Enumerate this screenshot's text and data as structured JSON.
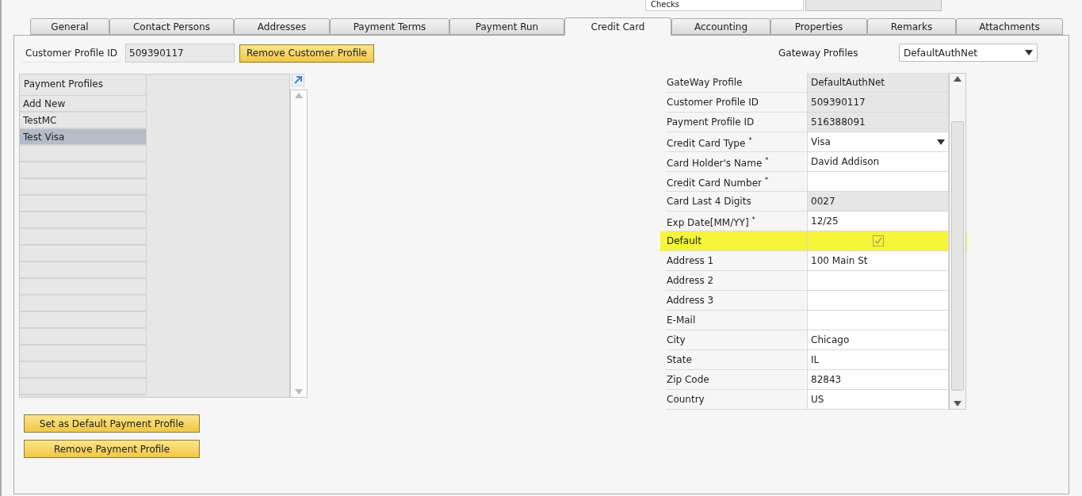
{
  "top_strip": {
    "label": "Checks"
  },
  "tabs": [
    {
      "label": "General",
      "selected": false
    },
    {
      "label": "Contact Persons",
      "selected": false
    },
    {
      "label": "Addresses",
      "selected": false
    },
    {
      "label": "Payment Terms",
      "selected": false
    },
    {
      "label": "Payment Run",
      "selected": false
    },
    {
      "label": "Credit Card",
      "selected": true
    },
    {
      "label": "Accounting",
      "selected": false
    },
    {
      "label": "Properties",
      "selected": false
    },
    {
      "label": "Remarks",
      "selected": false
    },
    {
      "label": "Attachments",
      "selected": false
    }
  ],
  "customer_profile": {
    "label": "Customer Profile ID",
    "value": "509390117",
    "button": "Remove Customer Profile"
  },
  "gateway_profiles": {
    "label": "Gateway Profiles",
    "value": "DefaultAuthNet"
  },
  "payment_profiles": {
    "header": "Payment Profiles",
    "rows": [
      {
        "name": "Add New",
        "selected": false
      },
      {
        "name": "TestMC",
        "selected": false
      },
      {
        "name": "Test Visa",
        "selected": true
      }
    ]
  },
  "actions": [
    "Set as Default Payment Profile",
    "Remove Payment Profile"
  ],
  "profile_form": [
    {
      "label": "GateWay Profile",
      "kind": "readonly",
      "value": "DefaultAuthNet"
    },
    {
      "label": "Customer Profile ID",
      "kind": "readonly",
      "value": "509390117"
    },
    {
      "label": "Payment Profile ID",
      "kind": "readonly",
      "value": "516388091"
    },
    {
      "label": "Credit Card Type $^{*}$",
      "kind": "dropdown",
      "value": "Visa"
    },
    {
      "label": "Card Holder's Name $^{*}$",
      "kind": "text",
      "value": "David Addison"
    },
    {
      "label": "Credit Card Number $^{*}$",
      "kind": "text"
    },
    {
      "label": "Card Last 4 Digits",
      "kind": "readonly",
      "value": "0027"
    },
    {
      "label": "Exp Date[MM/YY] $^{*}$",
      "kind": "text",
      "value": "12/25"
    },
    {
      "label": "Default",
      "kind": "checkbox",
      "checked": true,
      "highlighted": true
    },
    {
      "label": "Address 1",
      "kind": "text",
      "value": "100 Main St"
    },
    {
      "label": "Address 2",
      "kind": "text"
    },
    {
      "label": "Address 3",
      "kind": "text"
    },
    {
      "label": "E-Mail",
      "kind": "text"
    },
    {
      "label": "City",
      "kind": "text",
      "value": "Chicago"
    },
    {
      "label": "State",
      "kind": "text",
      "value": "IL"
    },
    {
      "label": "Zip Code",
      "kind": "text",
      "value": "82843"
    },
    {
      "label": "Country",
      "kind": "text",
      "value": "US"
    }
  ]
}
